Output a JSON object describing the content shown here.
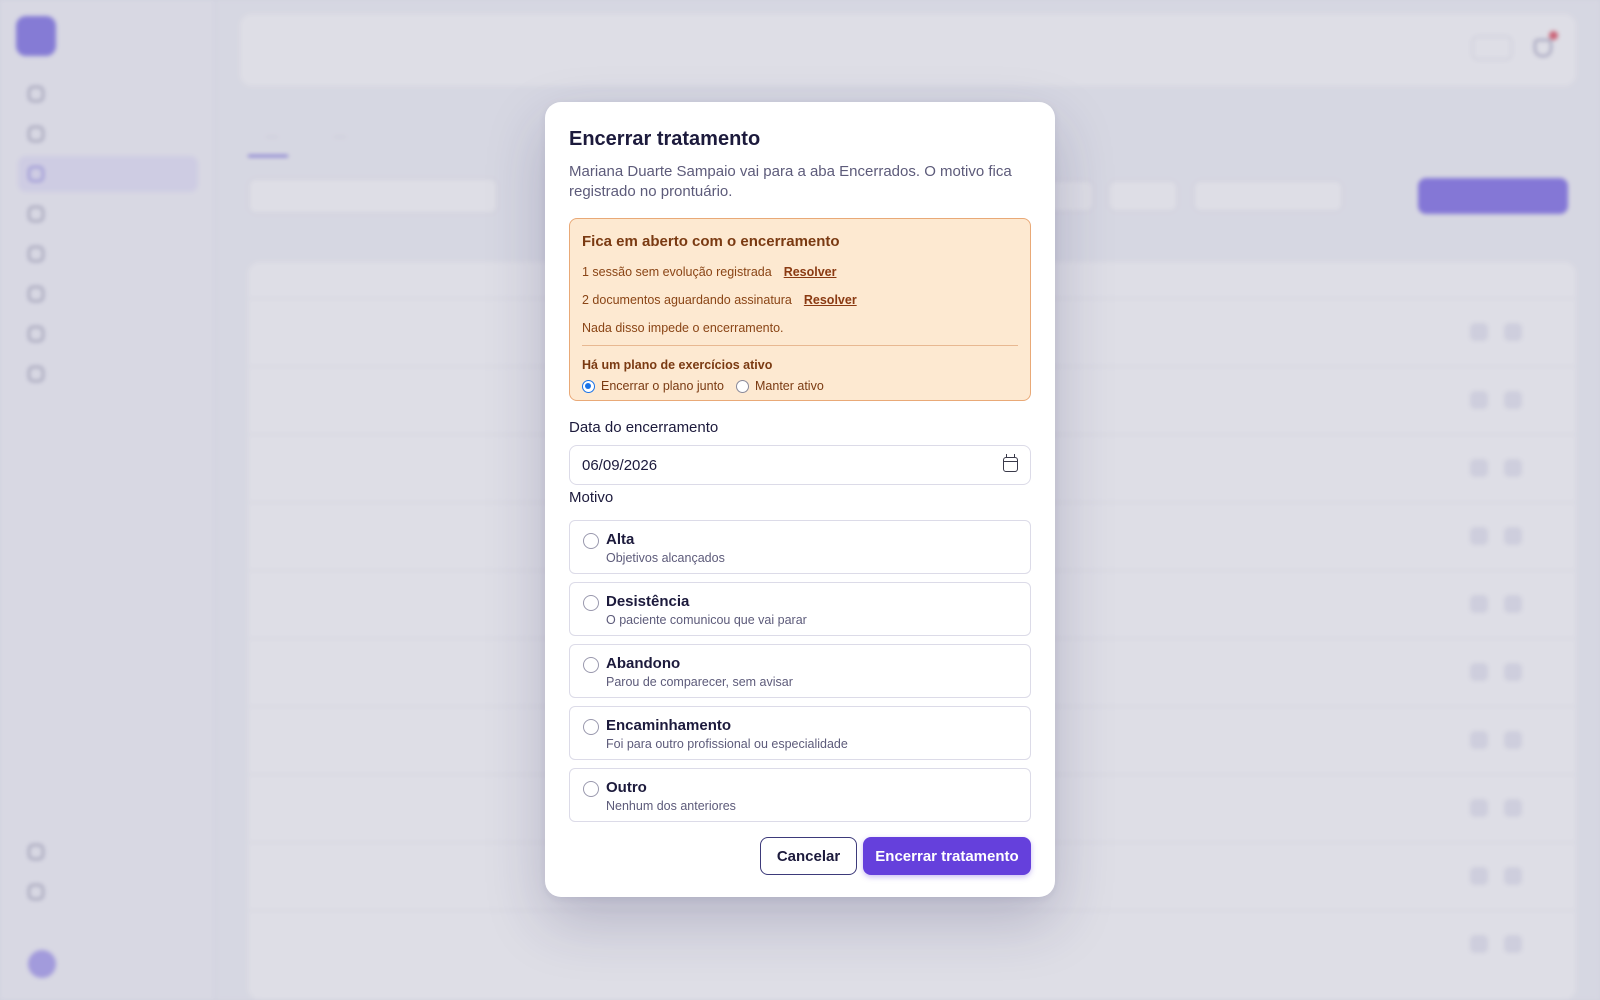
{
  "modal": {
    "title": "Encerrar tratamento",
    "description": "Mariana Duarte Sampaio vai para a aba Encerrados. O motivo fica registrado no prontuário.",
    "warning": {
      "title": "Fica em aberto com o encerramento",
      "items": [
        {
          "text": "1 sessão sem evolução registrada",
          "action": "Resolver"
        },
        {
          "text": "2 documentos aguardando assinatura",
          "action": "Resolver"
        }
      ],
      "note": "Nada disso impede o encerramento.",
      "plan_title": "Há um plano de exercícios ativo",
      "plan_options": [
        {
          "label": "Encerrar o plano junto",
          "selected": true
        },
        {
          "label": "Manter ativo",
          "selected": false
        }
      ]
    },
    "date_label": "Data do encerramento",
    "date_value": "06/09/2026",
    "reason_label": "Motivo",
    "reasons": [
      {
        "title": "Alta",
        "subtitle": "Objetivos alcançados"
      },
      {
        "title": "Desistência",
        "subtitle": "O paciente comunicou que vai parar"
      },
      {
        "title": "Abandono",
        "subtitle": "Parou de comparecer, sem avisar"
      },
      {
        "title": "Encaminhamento",
        "subtitle": "Foi para outro profissional ou especialidade"
      },
      {
        "title": "Outro",
        "subtitle": "Nenhum dos anteriores"
      }
    ],
    "cancel_label": "Cancelar",
    "confirm_label": "Encerrar tratamento"
  },
  "colors": {
    "accent": "#6540dc",
    "warning_bg": "#fde9d1",
    "warning_border": "#e9a977",
    "radio_selected": "#1a73e8"
  }
}
